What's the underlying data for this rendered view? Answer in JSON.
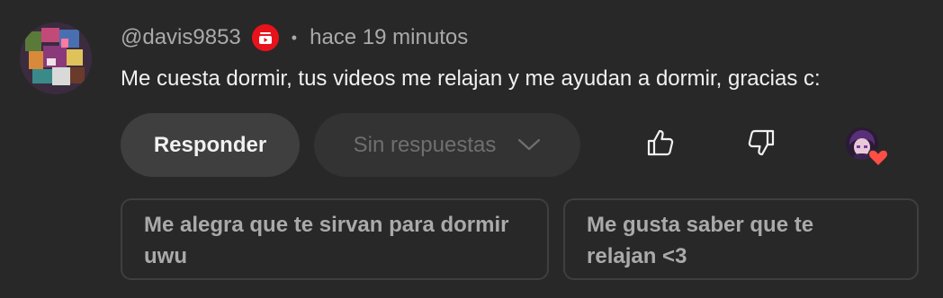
{
  "comment": {
    "handle": "@davis9853",
    "separator": "•",
    "time": "hace 19 minutos",
    "text": "Me cuesta dormir, tus videos me relajan y me ayudan a dormir, gracias c:"
  },
  "actions": {
    "reply_label": "Responder",
    "replies_label": "Sin respuestas"
  },
  "suggestions": [
    {
      "line1": "Me alegra que te sirvan para dormir",
      "line2": "uwu"
    },
    {
      "line1": "Me gusta saber que te",
      "line2": "relajan <3"
    }
  ],
  "icons": {
    "badge": "youtube-creator-badge-icon",
    "like": "thumbs-up-icon",
    "dislike": "thumbs-down-icon",
    "heart": "creator-heart-icon",
    "chevron": "chevron-down-icon"
  },
  "colors": {
    "background": "#282828",
    "badge_red": "#e8121b",
    "heart_red": "#ff4e45"
  }
}
